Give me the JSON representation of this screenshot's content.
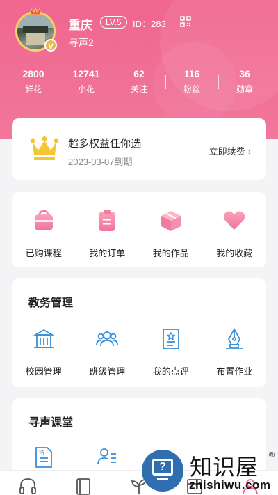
{
  "profile": {
    "name": "重庆",
    "level": "LV.5",
    "id_text": "ID：283",
    "subname": "寻声2",
    "vip_badge": "V"
  },
  "stats": [
    {
      "value": "2800",
      "label": "鲜花"
    },
    {
      "value": "12741",
      "label": "小花"
    },
    {
      "value": "62",
      "label": "关注"
    },
    {
      "value": "116",
      "label": "粉丝"
    },
    {
      "value": "36",
      "label": "勋章"
    }
  ],
  "vip": {
    "title": "超多权益任你选",
    "expire": "2023-03-07到期",
    "renew_label": "立即续费",
    "chevron": "›"
  },
  "quick": [
    {
      "label": "已购课程",
      "icon": "bag-icon"
    },
    {
      "label": "我的订单",
      "icon": "clipboard-icon"
    },
    {
      "label": "我的作品",
      "icon": "cube-icon"
    },
    {
      "label": "我的收藏",
      "icon": "heart-icon"
    }
  ],
  "edu": {
    "title": "教务管理",
    "items": [
      {
        "label": "校园管理",
        "icon": "school-building-icon"
      },
      {
        "label": "班级管理",
        "icon": "group-icon"
      },
      {
        "label": "我的点评",
        "icon": "review-doc-icon"
      },
      {
        "label": "布置作业",
        "icon": "pen-nib-icon"
      }
    ]
  },
  "classroom": {
    "title": "寻声课堂",
    "items": [
      {
        "label": "",
        "icon": "doc-icon",
        "icon_text": "待"
      },
      {
        "label": "",
        "icon": "user-list-icon"
      }
    ]
  },
  "tabs": [
    {
      "icon": "headphones-icon"
    },
    {
      "icon": "book-icon"
    },
    {
      "icon": "sprout-icon"
    },
    {
      "icon": "box-icon"
    },
    {
      "icon": "profile-icon"
    }
  ],
  "watermark": {
    "cn": "知识屋",
    "en": "zhishiwu.com",
    "reg": "®",
    "icon_text": "?"
  },
  "colors": {
    "header_pink": "#f0668f",
    "accent_pink": "#f07da0",
    "edu_blue": "#3a8fd6",
    "crown_gold": "#f5c533"
  }
}
